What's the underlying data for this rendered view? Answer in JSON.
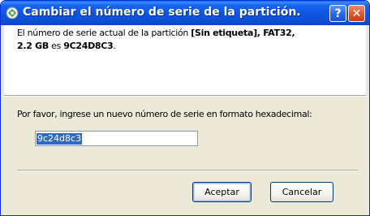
{
  "window": {
    "title": "Cambiar el número de serie de la partición.",
    "help_label": "?",
    "close_label": "✕"
  },
  "info": {
    "part1": "El número de serie actual de la partición ",
    "partition_name": "[Sin etiqueta]",
    "sep1": ", ",
    "filesystem": "FAT32",
    "sep2": ", ",
    "size": "2.2 GB",
    "mid": " es ",
    "serial": "9C24D8C3",
    "end": "."
  },
  "form": {
    "prompt": "Por favor, ingrese un nuevo número de serie en formato hexadecimal:",
    "serial_value": "9c24d8c3"
  },
  "buttons": {
    "accept": "Aceptar",
    "cancel": "Cancelar"
  }
}
